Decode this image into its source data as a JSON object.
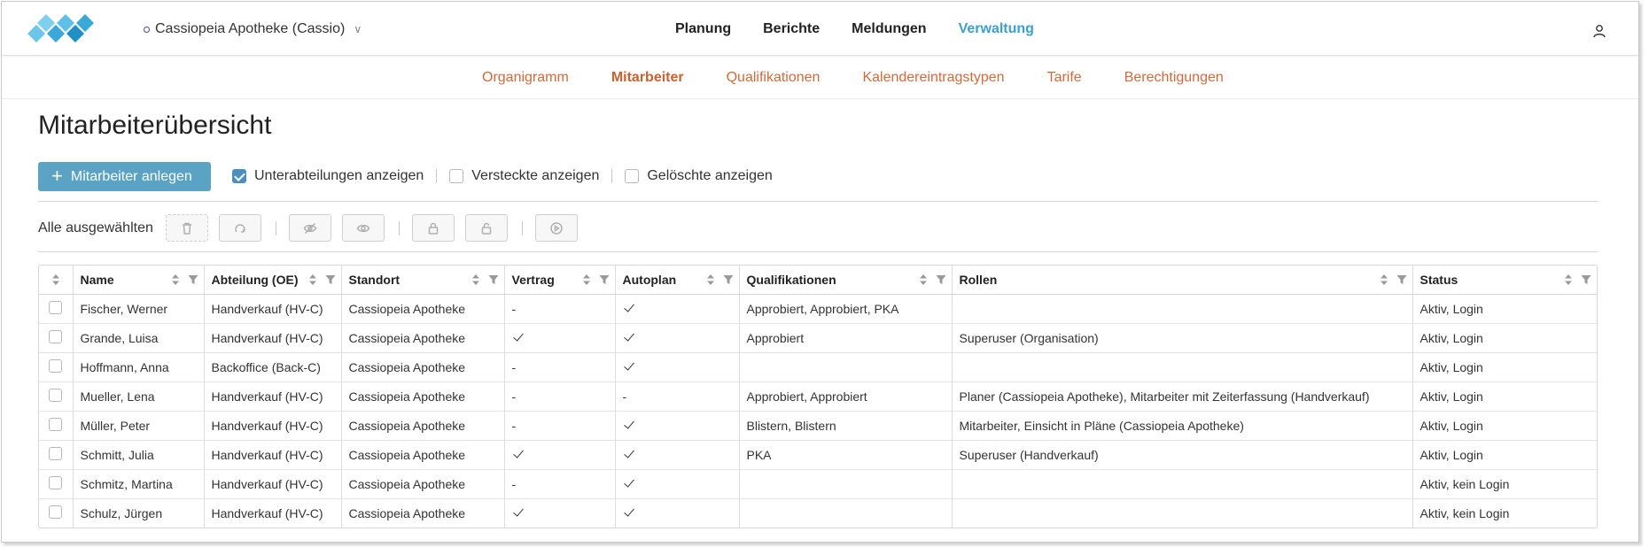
{
  "header": {
    "org": "Cassiopeia Apotheke (Cassio)",
    "nav": [
      "Planung",
      "Berichte",
      "Meldungen",
      "Verwaltung"
    ],
    "active_nav": "Verwaltung"
  },
  "subnav": {
    "items": [
      "Organigramm",
      "Mitarbeiter",
      "Qualifikationen",
      "Kalendereintragstypen",
      "Tarife",
      "Berechtigungen"
    ],
    "active": "Mitarbeiter"
  },
  "page": {
    "title": "Mitarbeiterübersicht",
    "add_button": "Mitarbeiter anlegen",
    "filters": [
      {
        "label": "Unterabteilungen anzeigen",
        "checked": true
      },
      {
        "label": "Versteckte anzeigen",
        "checked": false
      },
      {
        "label": "Gelöschte anzeigen",
        "checked": false
      }
    ],
    "bulk_label": "Alle ausgewählten"
  },
  "colors": {
    "accent_blue": "#3c9fd0",
    "button_blue": "#5aa3c4",
    "subnav_orange": "#d06b3e"
  },
  "table": {
    "columns": [
      "Name",
      "Abteilung (OE)",
      "Standort",
      "Vertrag",
      "Autoplan",
      "Qualifikationen",
      "Rollen",
      "Status"
    ],
    "rows": [
      {
        "name": "Fischer, Werner",
        "abteilung": "Handverkauf (HV-C)",
        "standort": "Cassiopeia Apotheke",
        "vertrag": "-",
        "autoplan": "check",
        "qualifikationen": "Approbiert, Approbiert, PKA",
        "rollen": "",
        "status": "Aktiv, Login"
      },
      {
        "name": "Grande, Luisa",
        "abteilung": "Handverkauf (HV-C)",
        "standort": "Cassiopeia Apotheke",
        "vertrag": "check",
        "autoplan": "check",
        "qualifikationen": "Approbiert",
        "rollen": "Superuser (Organisation)",
        "status": "Aktiv, Login"
      },
      {
        "name": "Hoffmann, Anna",
        "abteilung": "Backoffice (Back-C)",
        "standort": "Cassiopeia Apotheke",
        "vertrag": "-",
        "autoplan": "check",
        "qualifikationen": "",
        "rollen": "",
        "status": "Aktiv, Login"
      },
      {
        "name": "Mueller, Lena",
        "abteilung": "Handverkauf (HV-C)",
        "standort": "Cassiopeia Apotheke",
        "vertrag": "-",
        "autoplan": "-",
        "qualifikationen": "Approbiert, Approbiert",
        "rollen": "Planer (Cassiopeia Apotheke), Mitarbeiter mit Zeiterfassung (Handverkauf)",
        "status": "Aktiv, Login"
      },
      {
        "name": "Müller, Peter",
        "abteilung": "Handverkauf (HV-C)",
        "standort": "Cassiopeia Apotheke",
        "vertrag": "-",
        "autoplan": "check",
        "qualifikationen": "Blistern, Blistern",
        "rollen": "Mitarbeiter, Einsicht in Pläne (Cassiopeia Apotheke)",
        "status": "Aktiv, Login"
      },
      {
        "name": "Schmitt, Julia",
        "abteilung": "Handverkauf (HV-C)",
        "standort": "Cassiopeia Apotheke",
        "vertrag": "check",
        "autoplan": "check",
        "qualifikationen": "PKA",
        "rollen": "Superuser (Handverkauf)",
        "status": "Aktiv, Login"
      },
      {
        "name": "Schmitz, Martina",
        "abteilung": "Handverkauf (HV-C)",
        "standort": "Cassiopeia Apotheke",
        "vertrag": "-",
        "autoplan": "check",
        "qualifikationen": "",
        "rollen": "",
        "status": "Aktiv, kein Login"
      },
      {
        "name": "Schulz, Jürgen",
        "abteilung": "Handverkauf (HV-C)",
        "standort": "Cassiopeia Apotheke",
        "vertrag": "check",
        "autoplan": "check",
        "qualifikationen": "",
        "rollen": "",
        "status": "Aktiv, kein Login"
      }
    ]
  }
}
